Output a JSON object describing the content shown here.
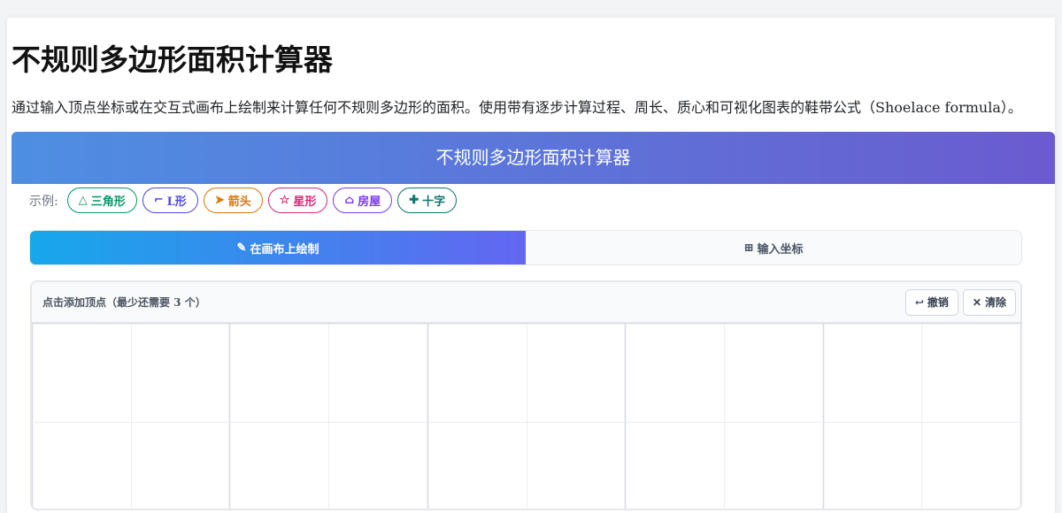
{
  "page": {
    "title": "不规则多边形面积计算器",
    "description": "通过输入顶点坐标或在交互式画布上绘制来计算任何不规则多边形的面积。使用带有逐步计算过程、周长、质心和可视化图表的鞋带公式（Shoelace formula）。"
  },
  "calculator": {
    "header_title": "不规则多边形面积计算器",
    "examples_label": "示例:",
    "examples": [
      {
        "icon": "△",
        "label": "三角形",
        "color": "#059669",
        "icon_name": "triangle-icon"
      },
      {
        "icon": "⌐",
        "label": "L形",
        "color": "#4f46e5",
        "icon_name": "l-shape-icon"
      },
      {
        "icon": "➤",
        "label": "箭头",
        "color": "#d97706",
        "icon_name": "arrow-icon"
      },
      {
        "icon": "☆",
        "label": "星形",
        "color": "#db2777",
        "icon_name": "star-icon"
      },
      {
        "icon": "⌂",
        "label": "房屋",
        "color": "#7c3aed",
        "icon_name": "house-icon"
      },
      {
        "icon": "✚",
        "label": "十字",
        "color": "#0f766e",
        "icon_name": "cross-icon"
      }
    ],
    "tabs": [
      {
        "icon": "✎",
        "label": "在画布上绘制",
        "icon_name": "pencil-icon"
      },
      {
        "icon": "⊞",
        "label": "输入坐标",
        "icon_name": "grid-icon"
      }
    ],
    "canvas": {
      "hint": "点击添加顶点（最少还需要 3 个）",
      "undo": {
        "icon": "↩",
        "label": "撤销"
      },
      "clear": {
        "icon": "✕",
        "label": "清除"
      }
    }
  }
}
